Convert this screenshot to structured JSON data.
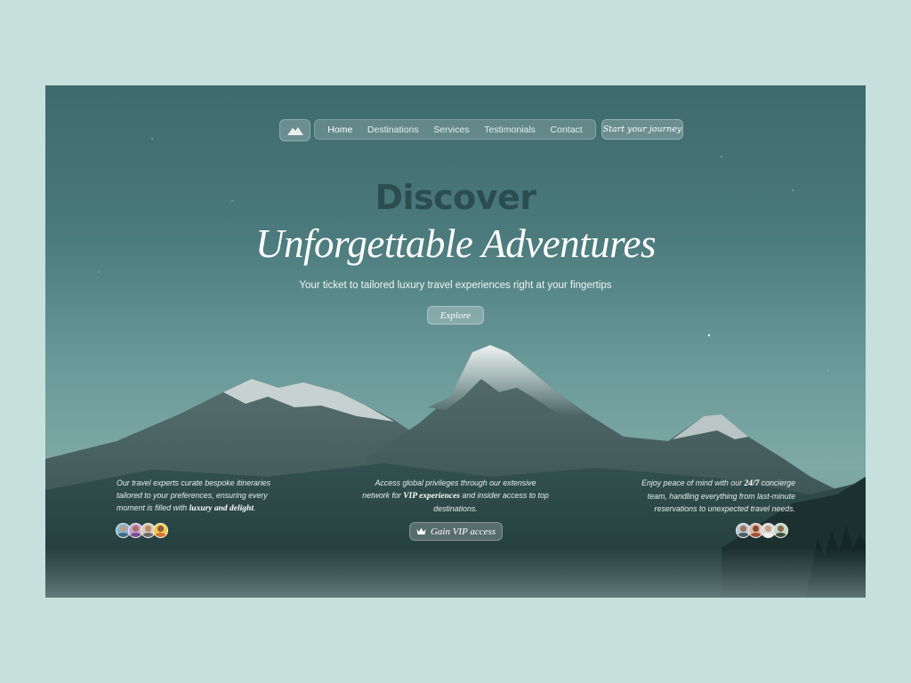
{
  "nav": {
    "logo_icon": "mountain-logo-icon",
    "links": [
      {
        "label": "Home",
        "active": true
      },
      {
        "label": "Destinations",
        "active": false
      },
      {
        "label": "Services",
        "active": false
      },
      {
        "label": "Testimonials",
        "active": false
      },
      {
        "label": "Contact",
        "active": false
      }
    ],
    "cta_label": "Start your journey"
  },
  "hero": {
    "line1": "Discover",
    "line2": "Unforgettable Adventures",
    "subtitle": "Your ticket to tailored luxury travel experiences right at your fingertips",
    "explore_label": "Explore"
  },
  "features": {
    "left": {
      "text_before": "Our travel experts curate bespoke itineraries tailored to your preferences, ensuring every moment is filled with ",
      "emphasis": "luxury and delight",
      "text_after": "."
    },
    "center": {
      "text_before": "Access global privileges through our extensive network for ",
      "emphasis": "VIP experiences",
      "text_after": " and insider access to top destinations.",
      "button_label": "Gain VIP access",
      "button_icon": "crown-icon"
    },
    "right": {
      "text_before": "Enjoy peace of mind with our ",
      "emphasis": "24/7",
      "text_after": " concierge team, handling everything from last-minute reservations to unexpected travel needs."
    }
  },
  "avatars": {
    "left": [
      "#7fb7d8",
      "#c9a0d8",
      "#d8c9b0",
      "#f2c94c"
    ],
    "right": [
      "#b7c9d8",
      "#e0b7a0",
      "#d8d8d8",
      "#c2d8c2"
    ]
  },
  "colors": {
    "page_bg": "#c6e0db",
    "hero_dark_text": "#2b4d4f",
    "text_light": "#ffffff"
  }
}
